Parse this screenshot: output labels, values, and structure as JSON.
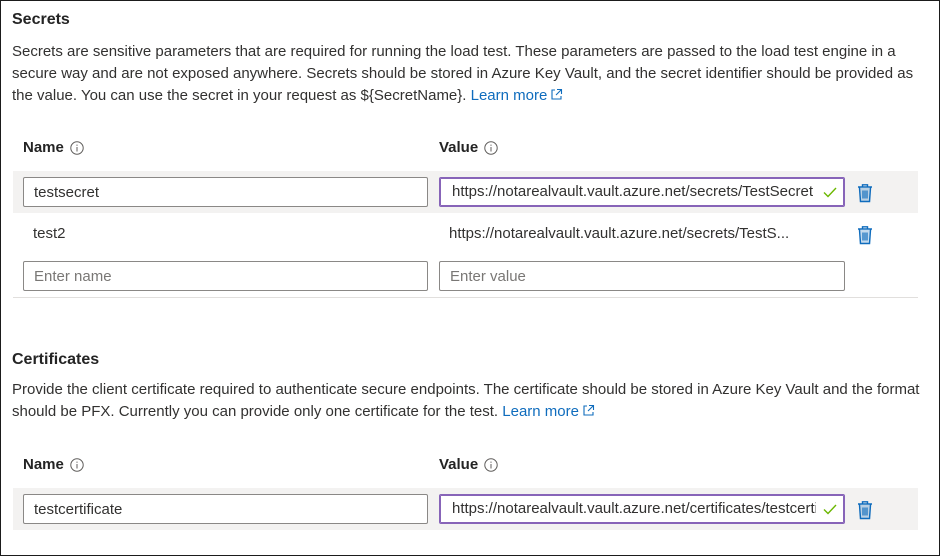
{
  "secrets": {
    "title": "Secrets",
    "description": "Secrets are sensitive parameters that are required for running the load test. These parameters are passed to the load test engine in a secure way and are not exposed anywhere. Secrets should be stored in Azure Key Vault, and the secret identifier should be provided as the value. You can use the secret in your request as ${SecretName}.",
    "learn_more": "Learn more",
    "name_header": "Name",
    "value_header": "Value",
    "rows": [
      {
        "name": "testsecret",
        "value": "https://notarealvault.vault.azure.net/secrets/TestSecret",
        "editing": true,
        "valid": true
      },
      {
        "name": "test2",
        "value": "https://notarealvault.vault.azure.net/secrets/TestS..."
      }
    ],
    "new_row": {
      "name_placeholder": "Enter name",
      "value_placeholder": "Enter value"
    }
  },
  "certificates": {
    "title": "Certificates",
    "description": "Provide the client certificate required to authenticate secure endpoints. The certificate should be stored in Azure Key Vault and the format should be PFX. Currently you can provide only one certificate for the test.",
    "learn_more": "Learn more",
    "name_header": "Name",
    "value_header": "Value",
    "rows": [
      {
        "name": "testcertificate",
        "value": "https://notarealvault.vault.azure.net/certificates/testcertificate",
        "editing": true,
        "valid": true
      }
    ]
  },
  "icons": {
    "info": "info-icon",
    "external_link": "external-link-icon",
    "delete": "trash-icon",
    "valid": "checkmark-icon"
  },
  "colors": {
    "link": "#0f6cbd",
    "focus_border": "#8764b8",
    "valid_check": "#6bb700",
    "delete_icon": "#0f6cbd"
  }
}
